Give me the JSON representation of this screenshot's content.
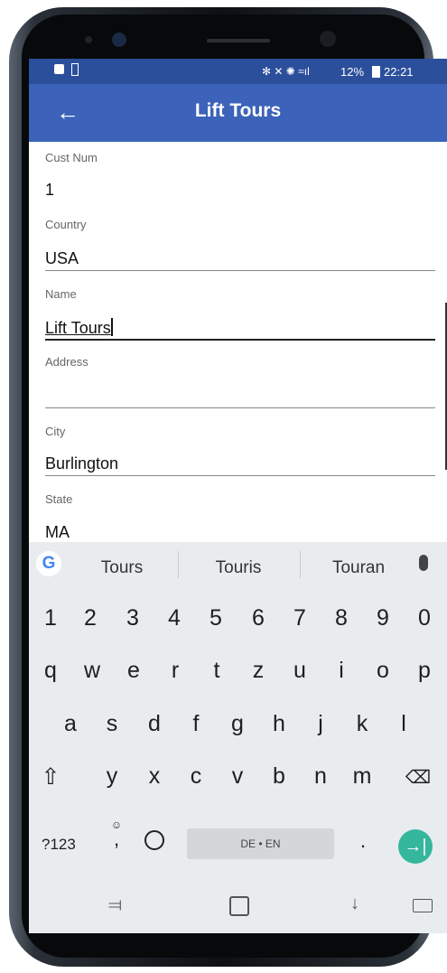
{
  "status_bar": {
    "left_icons": [
      "message-icon",
      "battery-alert-icon"
    ],
    "right_text": "✻ ⁜ ⊛ ⋒ ill 12%",
    "battery": "12%",
    "time": "22:21"
  },
  "app_bar": {
    "title": "Lift Tours",
    "back_icon": "back-arrow-icon"
  },
  "form": {
    "fields": [
      {
        "label": "Cust Num",
        "value": "1"
      },
      {
        "label": "Country",
        "value": "USA"
      },
      {
        "label": "Name",
        "value": "Lift Tours"
      },
      {
        "label": "Address",
        "value": ""
      },
      {
        "label": "City",
        "value": "Burlington"
      },
      {
        "label": "State",
        "value": "MA"
      }
    ]
  },
  "keyboard": {
    "suggestions": [
      "Tours",
      "Touris",
      "Touran"
    ],
    "numbers": [
      "1",
      "2",
      "3",
      "4",
      "5",
      "6",
      "7",
      "8",
      "9",
      "0"
    ],
    "row1": [
      "q",
      "w",
      "e",
      "r",
      "t",
      "z",
      "u",
      "i",
      "o",
      "p"
    ],
    "row2": [
      "a",
      "s",
      "d",
      "f",
      "g",
      "h",
      "j",
      "k",
      "l"
    ],
    "row3": [
      "y",
      "x",
      "c",
      "v",
      "b",
      "n",
      "m"
    ],
    "symbols_key": "?123",
    "comma_key": ",",
    "period_key": ".",
    "space_label": "DE • EN",
    "enter_glyph": "→|"
  },
  "colors": {
    "statusbar": "#2c4f9c",
    "appbar": "#3c63b9",
    "enter": "#34b79c"
  }
}
